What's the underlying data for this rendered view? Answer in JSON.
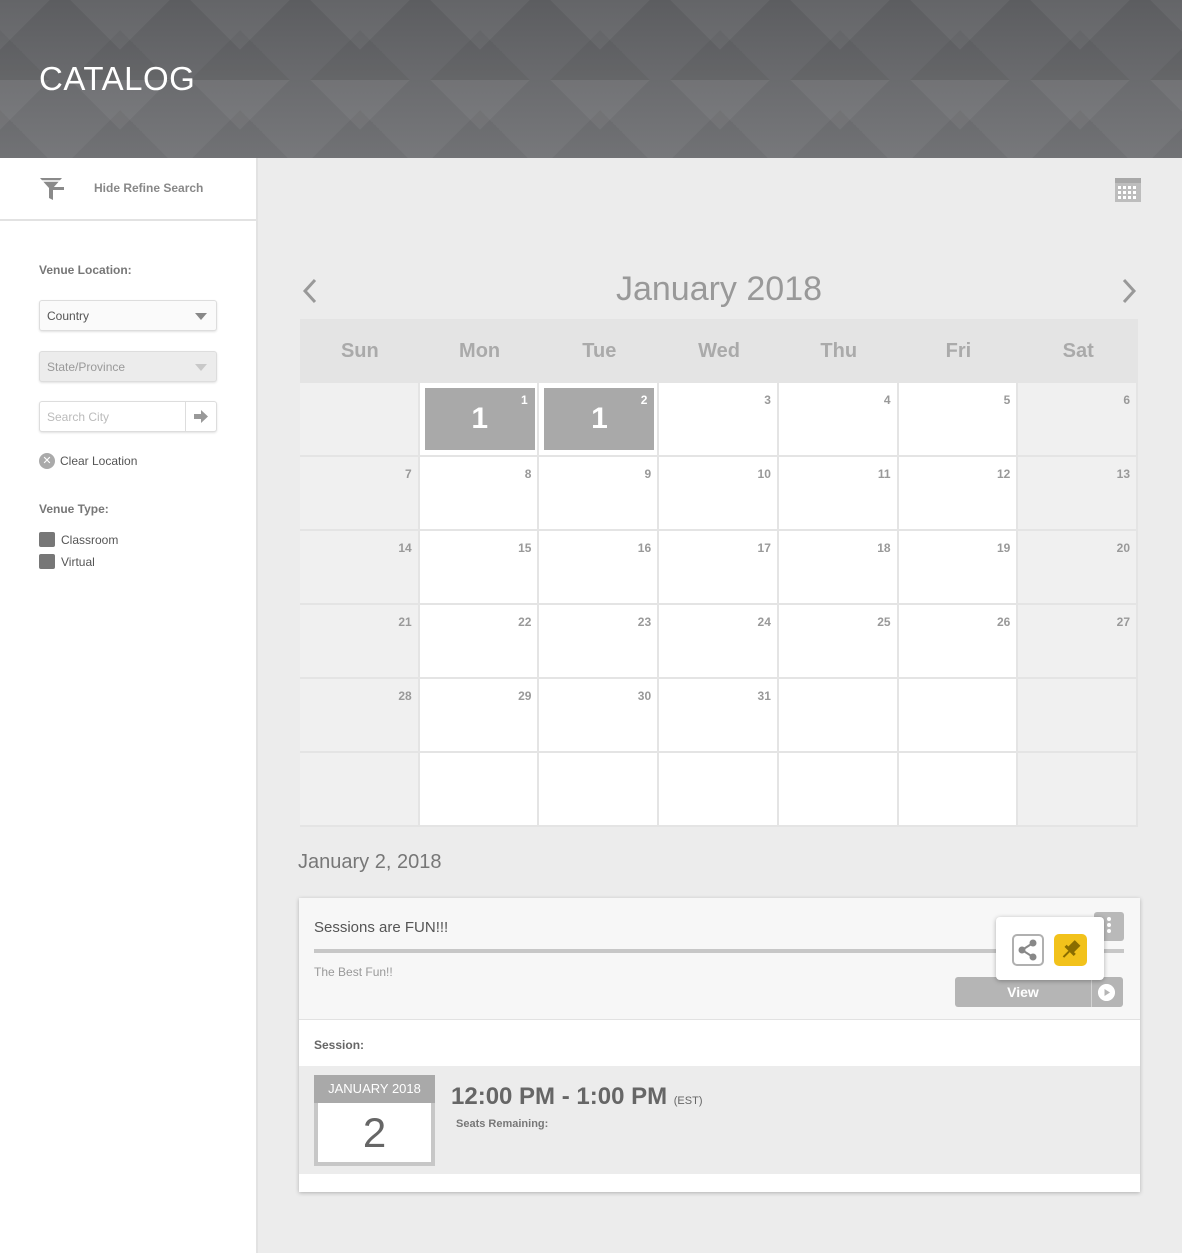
{
  "header": {
    "title": "CATALOG"
  },
  "sidebar": {
    "refine_toggle": "Hide Refine Search",
    "venue_location_label": "Venue Location:",
    "country_select": "Country",
    "state_select": "State/Province",
    "city_placeholder": "Search City",
    "clear_location": "Clear Location",
    "venue_type_label": "Venue Type:",
    "venue_types": [
      "Classroom",
      "Virtual"
    ]
  },
  "calendar": {
    "month_title": "January 2018",
    "weekdays": [
      "Sun",
      "Mon",
      "Tue",
      "Wed",
      "Thu",
      "Fri",
      "Sat"
    ],
    "event_counts": {
      "1": "1",
      "2": "1"
    },
    "day_numbers": [
      "",
      "1",
      "2",
      "3",
      "4",
      "5",
      "6",
      "7",
      "8",
      "9",
      "10",
      "11",
      "12",
      "13",
      "14",
      "15",
      "16",
      "17",
      "18",
      "19",
      "20",
      "21",
      "22",
      "23",
      "24",
      "25",
      "26",
      "27",
      "28",
      "29",
      "30",
      "31"
    ]
  },
  "selected_date": "January 2, 2018",
  "session_card": {
    "title": "Sessions are FUN!!!",
    "description": "The Best Fun!!",
    "view_label": "View",
    "session_label": "Session:",
    "date_month": "JANUARY 2018",
    "date_day": "2",
    "time": "12:00 PM - 1:00 PM",
    "timezone": "(EST)",
    "seats_label": "Seats Remaining:"
  },
  "colors": {
    "accent_pin": "#f2c21b",
    "event_fill": "#a9a9a9"
  }
}
